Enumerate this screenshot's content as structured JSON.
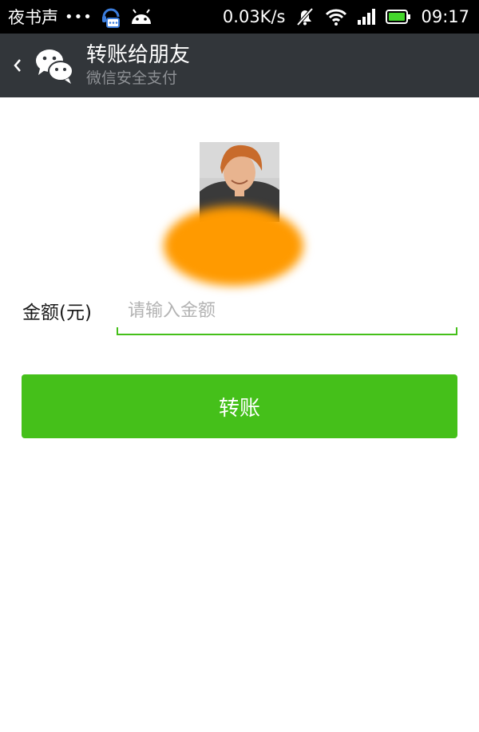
{
  "status_bar": {
    "app_name": "夜书声",
    "dots": "•••",
    "net_speed": "0.03K/s",
    "time": "09:17",
    "icons": [
      "headset-chat-icon",
      "android-icon",
      "mute-icon",
      "wifi-icon",
      "signal-icon",
      "battery-icon"
    ]
  },
  "header": {
    "title": "转账给朋友",
    "subtitle": "微信安全支付",
    "back_icon": "chevron-left-icon",
    "logo_icon": "wechat-logo-icon"
  },
  "recipient": {
    "avatar": "avatar-photo"
  },
  "form": {
    "amount_label": "金额(元)",
    "amount_placeholder": "请输入金额",
    "amount_value": ""
  },
  "actions": {
    "transfer_label": "转账"
  },
  "colors": {
    "status_bar_bg": "#000000",
    "title_bar_bg": "#32363a",
    "accent_green": "#45c01a",
    "redaction_orange": "#ff9a00"
  }
}
